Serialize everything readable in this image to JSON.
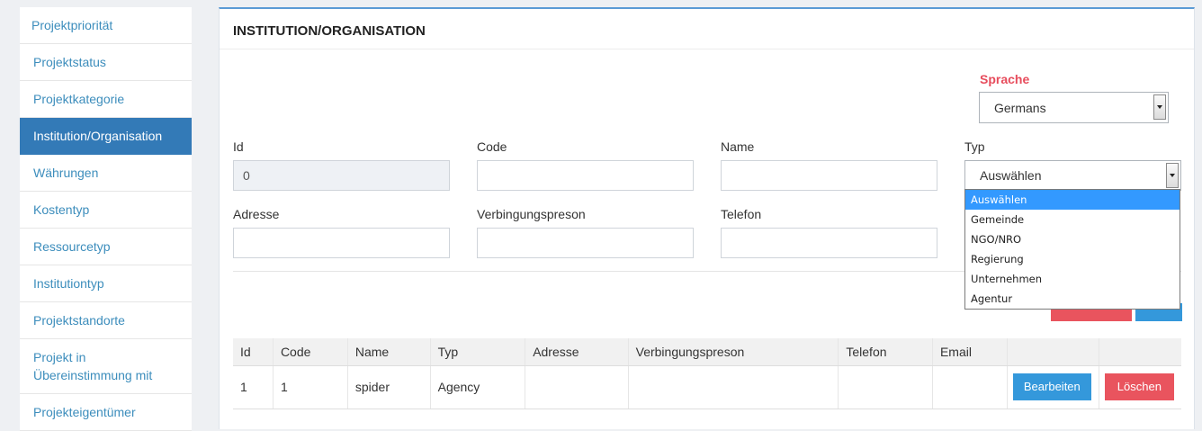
{
  "sidebar": {
    "items": [
      {
        "label": "Projektpriorität"
      },
      {
        "label": "Projektstatus"
      },
      {
        "label": "Projektkategorie"
      },
      {
        "label": "Institution/Organisation"
      },
      {
        "label": "Währungen"
      },
      {
        "label": "Kostentyp"
      },
      {
        "label": "Ressourcetyp"
      },
      {
        "label": "Institutiontyp"
      },
      {
        "label": "Projektstandorte"
      },
      {
        "label": "Projekt in Übereinstimmung mit"
      },
      {
        "label": "Projekteigentümer"
      }
    ]
  },
  "panel": {
    "title": "INSTITUTION/ORGANISATION"
  },
  "language": {
    "label": "Sprache",
    "selected": "Germans"
  },
  "form": {
    "id_label": "Id",
    "id_value": "0",
    "code_label": "Code",
    "name_label": "Name",
    "typ_label": "Typ",
    "typ_selected": "Auswählen",
    "adresse_label": "Adresse",
    "verbindung_label": "Verbingungspreson",
    "telefon_label": "Telefon"
  },
  "typ_options": [
    "Auswählen",
    "Gemeinde",
    "NGO/NRO",
    "Regierung",
    "Unternehmen",
    "Agentur"
  ],
  "table": {
    "headers": [
      "Id",
      "Code",
      "Name",
      "Typ",
      "Adresse",
      "Verbingungspreson",
      "Telefon",
      "Email",
      "",
      ""
    ],
    "rows": [
      {
        "id": "1",
        "code": "1",
        "name": "spider",
        "typ": "Agency",
        "adresse": "",
        "verbindung": "",
        "telefon": "",
        "email": "",
        "edit": "Bearbeiten",
        "delete": "Löschen"
      }
    ]
  },
  "colors": {
    "accent": "#337ab7",
    "link": "#3c8dbc",
    "danger": "#e9545e",
    "primary": "#3498db"
  }
}
